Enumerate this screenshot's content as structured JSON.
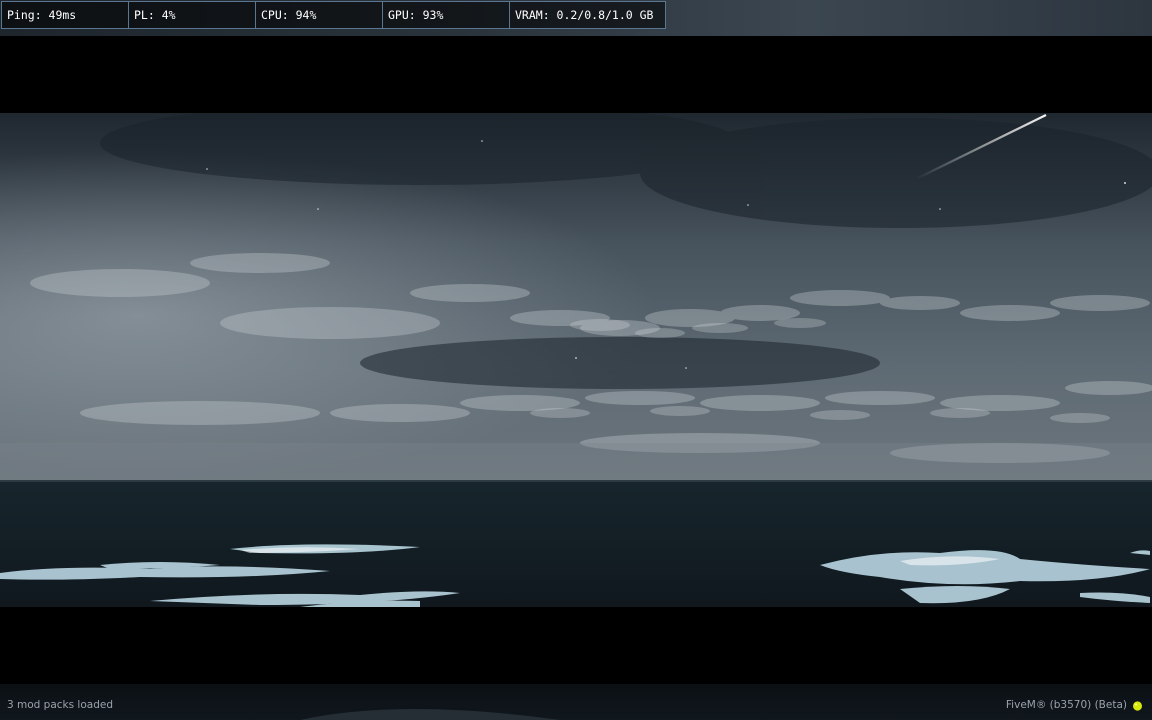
{
  "perf_hud": {
    "ping": "Ping: 49ms",
    "packet_loss": "PL: 4%",
    "cpu": "CPU: 94%",
    "gpu": "GPU: 93%",
    "vram": "VRAM: 0.2/0.8/1.0 GB"
  },
  "footer": {
    "mods_loaded": "3 mod packs loaded",
    "build_info": "FiveM® (b3570) (Beta)"
  },
  "colors": {
    "hud_border": "#5a7691",
    "hud_text": "#ffffff",
    "footer_text": "#9aa3ab",
    "fivem_icon": "#d8e80c"
  }
}
